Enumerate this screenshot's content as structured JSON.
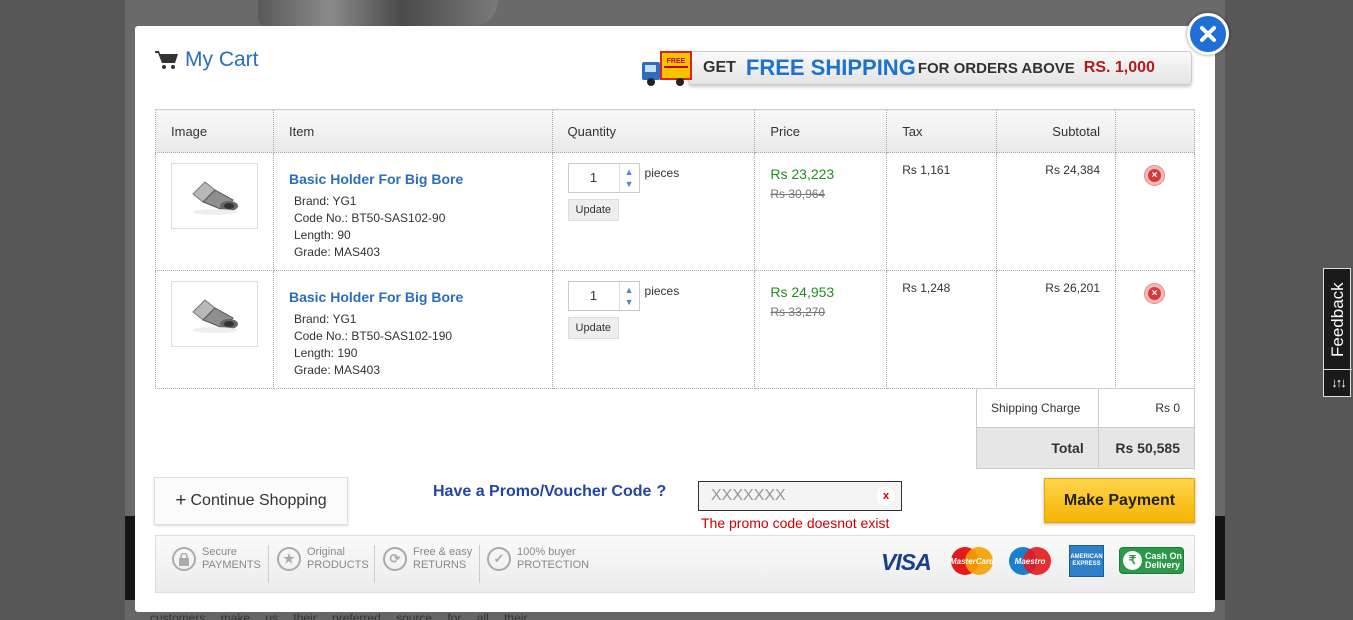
{
  "background": {
    "footer_text": "customers make us their preferred source for all their"
  },
  "modal": {
    "title": "My Cart"
  },
  "shipping_banner": {
    "truck_label": "FREE",
    "get": "GET",
    "free_shipping": "FREE SHIPPING",
    "for_orders_above": "FOR ORDERS ABOVE",
    "amount": "RS. 1,000"
  },
  "table": {
    "headers": {
      "image": "Image",
      "item": "Item",
      "quantity": "Quantity",
      "price": "Price",
      "tax": "Tax",
      "subtotal": "Subtotal"
    },
    "rows": [
      {
        "name": "Basic Holder For Big Bore",
        "brand_label": "Brand:",
        "brand": "YG1",
        "code_label": "Code No.:",
        "code": "BT50-SAS102-90",
        "length_label": "Length:",
        "length": "90",
        "grade_label": "Grade:",
        "grade": "MAS403",
        "qty": "1",
        "unit": "pieces",
        "update": "Update",
        "price": "Rs 23,223",
        "old_price": "Rs 30,964",
        "tax": "Rs 1,161",
        "subtotal": "Rs 24,384"
      },
      {
        "name": "Basic Holder For Big Bore",
        "brand_label": "Brand:",
        "brand": "YG1",
        "code_label": "Code No.:",
        "code": "BT50-SAS102-190",
        "length_label": "Length:",
        "length": "190",
        "grade_label": "Grade:",
        "grade": "MAS403",
        "qty": "1",
        "unit": "pieces",
        "update": "Update",
        "price": "Rs 24,953",
        "old_price": "Rs 33,270",
        "tax": "Rs 1,248",
        "subtotal": "Rs 26,201"
      }
    ]
  },
  "totals": {
    "shipping_label": "Shipping Charge",
    "shipping_value": "Rs 0",
    "total_label": "Total",
    "total_value": "Rs 50,585"
  },
  "actions": {
    "continue_shopping": "Continue Shopping",
    "promo_label": "Have a Promo/Voucher Code",
    "promo_q": "?",
    "promo_placeholder": "XXXXXXX",
    "promo_clear": "x",
    "promo_error": "The promo code doesnot exist",
    "make_payment": "Make Payment"
  },
  "trust_badges": [
    {
      "line1": "Secure",
      "line2": "PAYMENTS",
      "icon": "lock-icon"
    },
    {
      "line1": "Original",
      "line2": "PRODUCTS",
      "icon": "star-icon"
    },
    {
      "line1": "Free & easy",
      "line2": "RETURNS",
      "icon": "refresh-icon"
    },
    {
      "line1": "100% buyer",
      "line2": "PROTECTION",
      "icon": "check-icon"
    }
  ],
  "payment_methods": {
    "visa": "VISA",
    "mastercard": "MasterCard",
    "maestro": "Maestro",
    "amex": "AMERICAN EXPRESS",
    "cod_symbol": "₹",
    "cod_line1": "Cash On",
    "cod_line2": "Delivery"
  },
  "feedback": {
    "label": "Feedback",
    "icon": "↓↑↓"
  },
  "colors": {
    "link_blue": "#2a6ebc",
    "price_green": "#1f8f1f",
    "error_red": "#cc0000",
    "pay_yellow": "#f5b400",
    "close_blue": "#1e6fd6"
  }
}
